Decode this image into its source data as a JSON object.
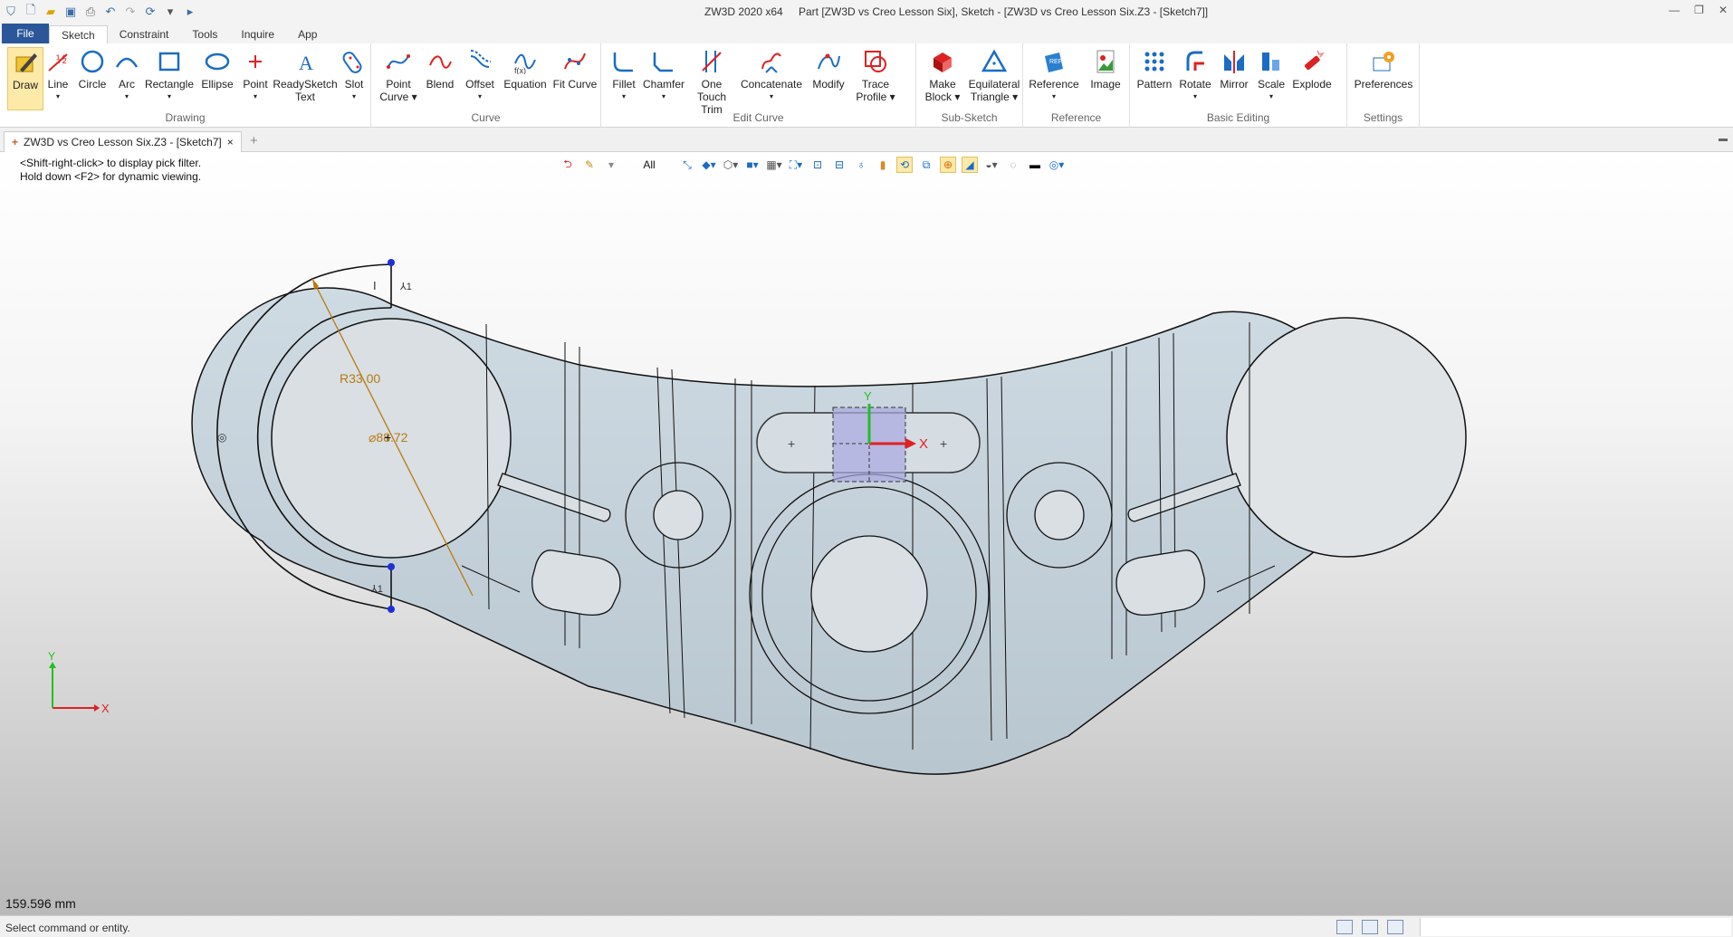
{
  "titlebar": {
    "app_title": "ZW3D 2020 x64",
    "doc_title": "Part [ZW3D vs Creo Lesson Six],  Sketch - [ZW3D vs Creo Lesson Six.Z3 - [Sketch7]]",
    "quick_access": [
      "app-logo-icon",
      "new-icon",
      "open-icon",
      "save-icon",
      "print-icon",
      "undo-icon",
      "redo-icon",
      "rebuild-icon",
      "customize-icon",
      "run-icon"
    ],
    "window_controls": [
      "minimize-icon",
      "restore-icon",
      "close-icon"
    ]
  },
  "ribbon_tabs": {
    "file": "File",
    "items": [
      "Sketch",
      "Constraint",
      "Tools",
      "Inquire",
      "App"
    ],
    "active": "Sketch"
  },
  "ribbon": {
    "groups": [
      {
        "label": "Drawing",
        "buttons": [
          "Draw",
          "Line",
          "Circle",
          "Arc",
          "Rectangle",
          "Ellipse",
          "Point",
          "ReadySketch Text",
          "Slot"
        ]
      },
      {
        "label": "Curve",
        "buttons": [
          "Point Curve",
          "Blend",
          "Offset",
          "Equation",
          "Fit Curve"
        ]
      },
      {
        "label": "Edit Curve",
        "buttons": [
          "Fillet",
          "Chamfer",
          "One Touch Trim",
          "Concatenate",
          "Modify",
          "Trace Profile"
        ]
      },
      {
        "label": "Sub-Sketch",
        "buttons": [
          "Make Block",
          "Equilateral Triangle"
        ]
      },
      {
        "label": "Reference",
        "buttons": [
          "Reference",
          "Image"
        ]
      },
      {
        "label": "Basic Editing",
        "buttons": [
          "Pattern",
          "Rotate",
          "Mirror",
          "Scale",
          "Explode"
        ]
      },
      {
        "label": "Settings",
        "buttons": [
          "Preferences"
        ]
      }
    ],
    "btn": {
      "draw": "Draw",
      "line": "Line",
      "circle": "Circle",
      "arc": "Arc",
      "rectangle": "Rectangle",
      "ellipse": "Ellipse",
      "point": "Point",
      "readysketch_1": "ReadySketch",
      "readysketch_2": "Text",
      "slot": "Slot",
      "pointcurve_1": "Point",
      "pointcurve_2": "Curve",
      "blend": "Blend",
      "offset": "Offset",
      "equation": "Equation",
      "fitcurve": "Fit Curve",
      "fillet": "Fillet",
      "chamfer": "Chamfer",
      "onetouch_1": "One Touch",
      "onetouch_2": "Trim",
      "concatenate": "Concatenate",
      "modify": "Modify",
      "trace_1": "Trace",
      "trace_2": "Profile",
      "makeblock_1": "Make",
      "makeblock_2": "Block",
      "equi_1": "Equilateral",
      "equi_2": "Triangle",
      "reference": "Reference",
      "image": "Image",
      "pattern": "Pattern",
      "rotate": "Rotate",
      "mirror": "Mirror",
      "scale": "Scale",
      "explode": "Explode",
      "preferences": "Preferences"
    },
    "group_labels": {
      "drawing": "Drawing",
      "curve": "Curve",
      "edit_curve": "Edit Curve",
      "sub_sketch": "Sub-Sketch",
      "reference": "Reference",
      "basic_editing": "Basic Editing",
      "settings": "Settings"
    }
  },
  "doc_tab": {
    "label": "ZW3D vs Creo Lesson Six.Z3 - [Sketch7]",
    "close": "×",
    "add": "+"
  },
  "viewport": {
    "hint_line1": "<Shift-right-click> to display pick filter.",
    "hint_line2": "Hold down <F2> for dynamic viewing.",
    "pick_filter": "All",
    "dim_radius": "R33.00",
    "dim_diameter": "⌀88.72",
    "axis_x": "X",
    "axis_y": "Y",
    "triad_x": "X",
    "triad_y": "Y",
    "measurement": "159.596 mm",
    "marker_i": "I",
    "marker_1a": "⅄1",
    "marker_1b": "⅄1",
    "colors": {
      "part_fill": "#c6d3dc",
      "sketch_line": "#111111",
      "dimension": "#b87a10",
      "point": "#1f2fd8",
      "axis_x": "#e02020",
      "axis_y": "#20c020"
    }
  },
  "status": {
    "text": "Select command or entity."
  }
}
